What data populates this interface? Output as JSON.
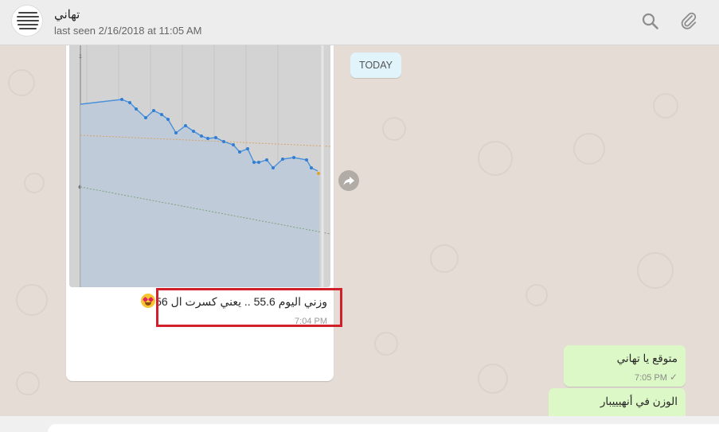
{
  "header": {
    "contact_name": "تهاني",
    "last_seen": "last seen 2/16/2018 at 11:05 AM",
    "icons": [
      "search-icon",
      "attach-icon"
    ]
  },
  "chat": {
    "date_divider": "TODAY",
    "messages": [
      {
        "type": "image",
        "direction": "incoming",
        "caption": "وزني اليوم 55.6 .. يعني كسرت ال 56",
        "emoji": "smiling-face-with-heart-eyes",
        "time": "7:04 PM",
        "highlight_color": "#d0212b"
      },
      {
        "type": "text",
        "direction": "outgoing",
        "text": "متوقع يا تهاني",
        "time": "7:05 PM",
        "status": "✓"
      },
      {
        "type": "text",
        "direction": "outgoing",
        "text": "الوزن في أنهيييبار",
        "time": ""
      }
    ]
  },
  "colors": {
    "chat_bg": "#e5ddd5",
    "outgoing_bubble": "#dcf8c6",
    "date_chip": "#e1f3fb",
    "highlight_box": "#d0212b"
  }
}
